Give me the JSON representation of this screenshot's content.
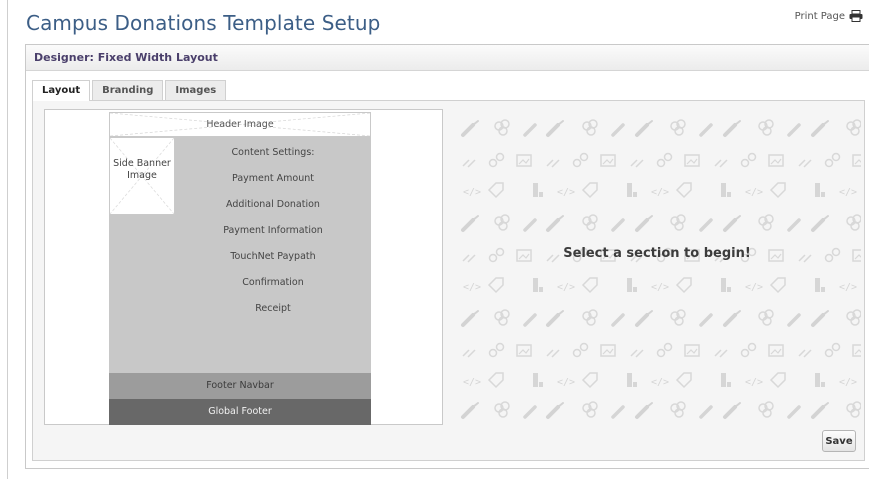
{
  "page": {
    "title": "Campus Donations Template Setup",
    "print_label": "Print Page",
    "print_icon": "printer-icon"
  },
  "panel": {
    "header": "Designer: Fixed Width Layout"
  },
  "tabs": [
    {
      "label": "Layout",
      "active": true
    },
    {
      "label": "Branding",
      "active": false
    },
    {
      "label": "Images",
      "active": false
    }
  ],
  "layout": {
    "header_image": "Header Image",
    "side_banner": "Side Banner Image",
    "content_items": [
      "Content Settings:",
      "Payment Amount",
      "Additional Donation",
      "Payment Information",
      "TouchNet Paypath",
      "Confirmation",
      "Receipt"
    ],
    "footer_navbar": "Footer Navbar",
    "global_footer": "Global Footer"
  },
  "message": "Select a section to begin!",
  "save_label": "Save",
  "colors": {
    "title": "#3c5e86",
    "panel_header": "#4a3f6b",
    "content_area": "#c8c8c8",
    "footer_navbar": "#9c9c9c",
    "global_footer": "#686868"
  }
}
